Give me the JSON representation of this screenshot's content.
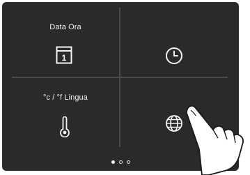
{
  "tiles": [
    {
      "label": "Data Ora",
      "icon": "calendar-icon",
      "icon_text": "1"
    },
    {
      "label": "",
      "icon": "clock-icon"
    },
    {
      "label": "°c / °f Lingua",
      "icon": "thermometer-icon"
    },
    {
      "label": "",
      "icon": "globe-icon"
    }
  ],
  "pager": {
    "count": 3,
    "active_index": 0
  },
  "colors": {
    "background": "#2a2a2a",
    "divider": "#4a4a4a",
    "foreground": "#f2f2f2"
  }
}
